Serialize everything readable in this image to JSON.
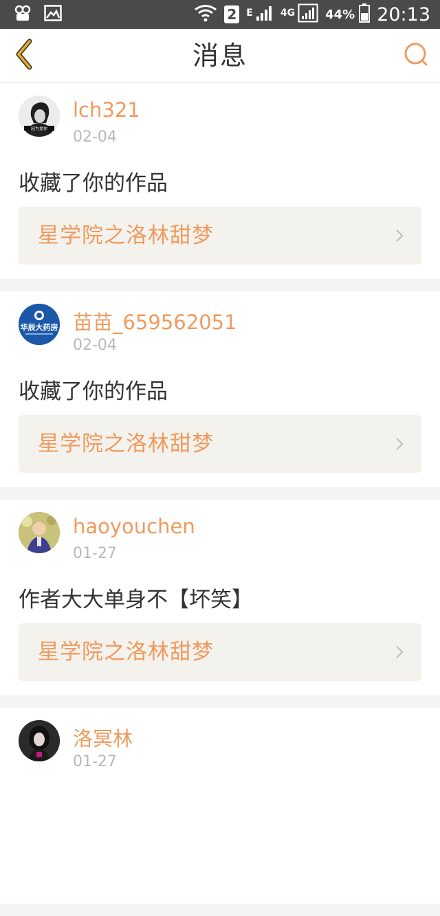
{
  "status_bar": {
    "sim_slot": "2",
    "network_e": "E",
    "network_4g": "4G",
    "battery_percent": "44%",
    "time": "20:13"
  },
  "header": {
    "title": "消息",
    "back_icon": "chevron-left-icon",
    "search_icon": "search-icon"
  },
  "colors": {
    "accent": "#f09a5e",
    "back_icon": "#f2b01e"
  },
  "messages": [
    {
      "username": "lch321",
      "date": "02-04",
      "text": "收藏了你的作品",
      "work_title": "星学院之洛林甜梦",
      "avatar_text": "因为爱你"
    },
    {
      "username": "苗苗_659562051",
      "date": "02-04",
      "text": "收藏了你的作品",
      "work_title": "星学院之洛林甜梦",
      "avatar_text": "华辰大药房"
    },
    {
      "username": "haoyouchen",
      "date": "01-27",
      "text": "作者大大单身不【坏笑】",
      "work_title": "星学院之洛林甜梦",
      "avatar_text": ""
    },
    {
      "username": "洛冥林",
      "date": "01-27",
      "text": "",
      "work_title": "",
      "avatar_text": ""
    }
  ]
}
